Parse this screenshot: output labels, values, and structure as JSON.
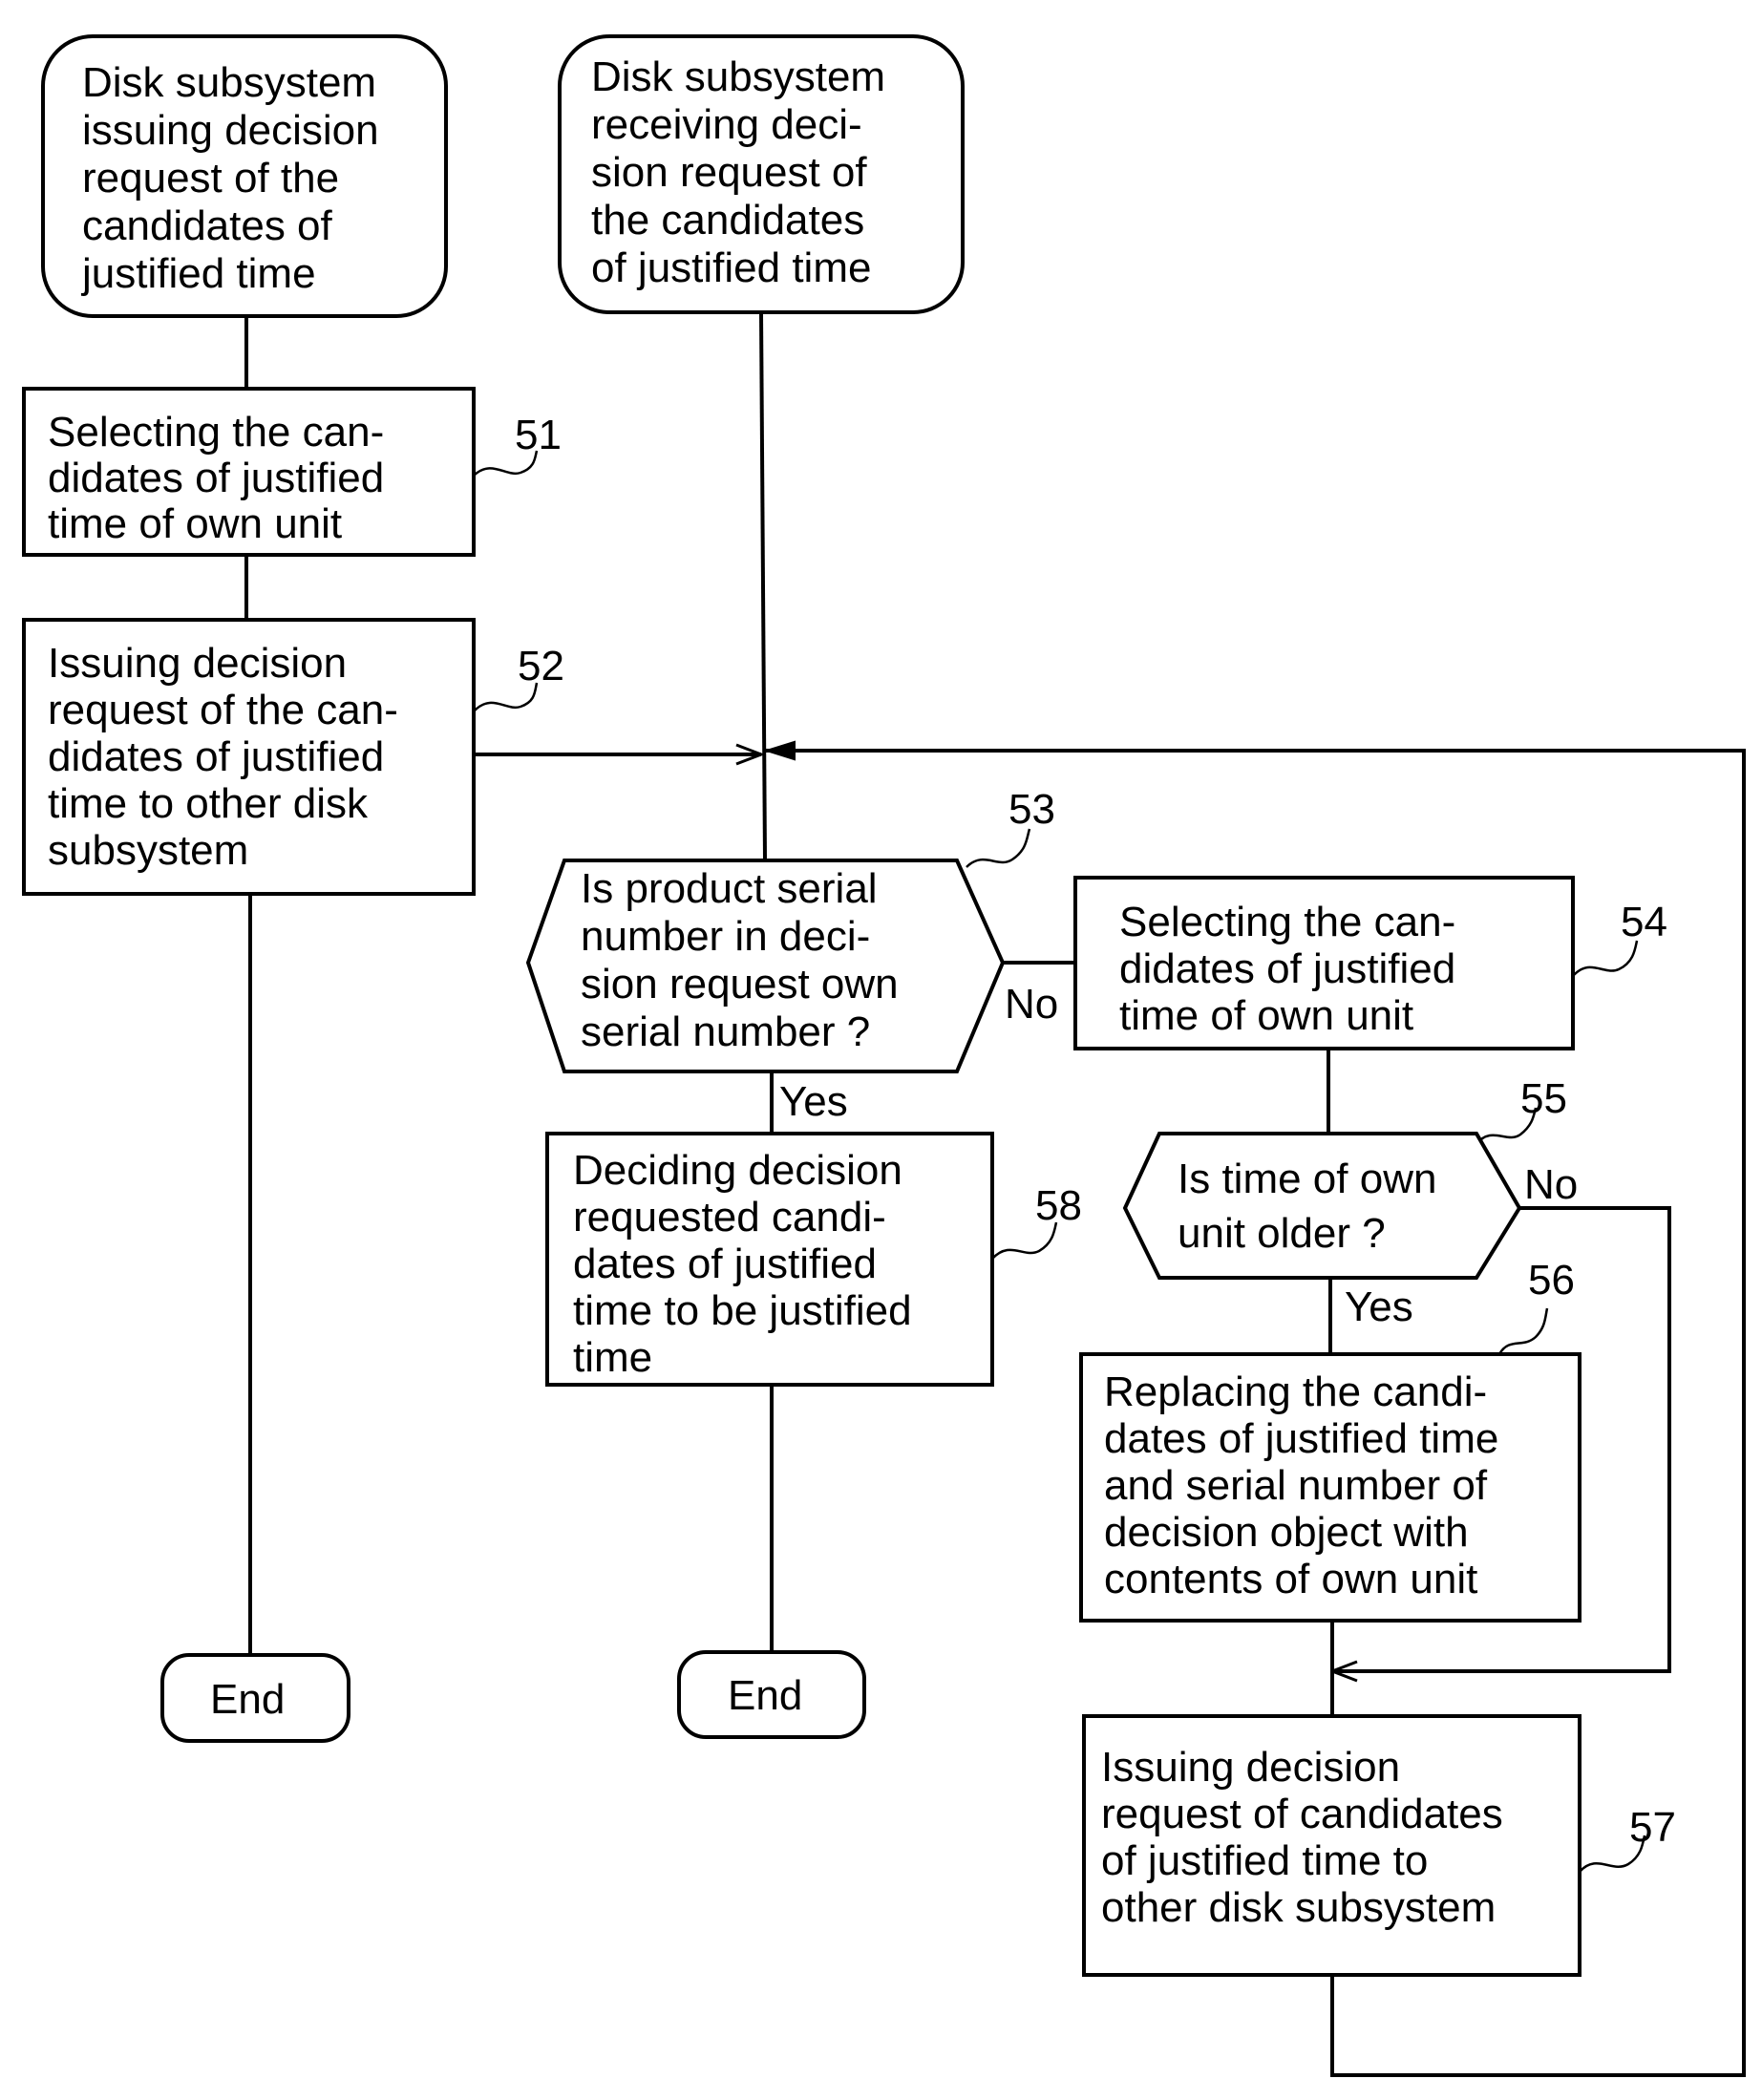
{
  "diagram": {
    "type": "flowchart",
    "nodes": {
      "start_issuing": {
        "kind": "terminal",
        "lines": [
          "Disk subsystem",
          "issuing decision",
          "request of the",
          "candidates of",
          "justified time"
        ]
      },
      "start_receiving": {
        "kind": "terminal",
        "lines": [
          "Disk subsystem",
          "receiving deci-",
          "sion request of",
          "the candidates",
          "of justified time"
        ]
      },
      "step51": {
        "kind": "process",
        "ref": "51",
        "lines": [
          "Selecting the can-",
          "didates of justified",
          "time of own unit"
        ]
      },
      "step52": {
        "kind": "process",
        "ref": "52",
        "lines": [
          "Issuing decision",
          "request of the can-",
          "didates of justified",
          "time to other disk",
          "subsystem"
        ]
      },
      "step53": {
        "kind": "decision",
        "ref": "53",
        "lines": [
          "Is product serial",
          "number in deci-",
          "sion request own",
          "serial number ?"
        ]
      },
      "step54": {
        "kind": "process",
        "ref": "54",
        "lines": [
          "Selecting the can-",
          "didates of justified",
          "time of own unit"
        ]
      },
      "step55": {
        "kind": "decision",
        "ref": "55",
        "lines": [
          "Is time of own",
          "unit older ?"
        ]
      },
      "step56": {
        "kind": "process",
        "ref": "56",
        "lines": [
          "Replacing the candi-",
          "dates of justified time",
          "and serial number of",
          "decision object with",
          "contents of own unit"
        ]
      },
      "step57": {
        "kind": "process",
        "ref": "57",
        "lines": [
          "Issuing decision",
          "request of candidates",
          "of justified time to",
          "other disk subsystem"
        ]
      },
      "step58": {
        "kind": "process",
        "ref": "58",
        "lines": [
          "Deciding decision",
          "requested candi-",
          "dates of justified",
          "time to be justified",
          "time"
        ]
      },
      "end_left": {
        "kind": "terminal",
        "lines": [
          "End"
        ]
      },
      "end_middle": {
        "kind": "terminal",
        "lines": [
          "End"
        ]
      }
    },
    "edge_labels": {
      "s53_no": "No",
      "s53_yes": "Yes",
      "s55_no": "No",
      "s55_yes": "Yes"
    },
    "edges": [
      {
        "from": "start_issuing",
        "to": "step51"
      },
      {
        "from": "step51",
        "to": "step52"
      },
      {
        "from": "step52",
        "to": "end_left"
      },
      {
        "from": "step52",
        "to": "step53",
        "arrow": true
      },
      {
        "from": "start_receiving",
        "to": "step53"
      },
      {
        "from": "step53",
        "to": "step54",
        "label": "No"
      },
      {
        "from": "step53",
        "to": "step58",
        "label": "Yes"
      },
      {
        "from": "step58",
        "to": "end_middle"
      },
      {
        "from": "step54",
        "to": "step55"
      },
      {
        "from": "step55",
        "to": "step56",
        "label": "Yes"
      },
      {
        "from": "step55",
        "to": "step57",
        "label": "No",
        "arrow": true
      },
      {
        "from": "step56",
        "to": "step57"
      },
      {
        "from": "step57",
        "to": "step53",
        "arrow": true
      }
    ]
  }
}
